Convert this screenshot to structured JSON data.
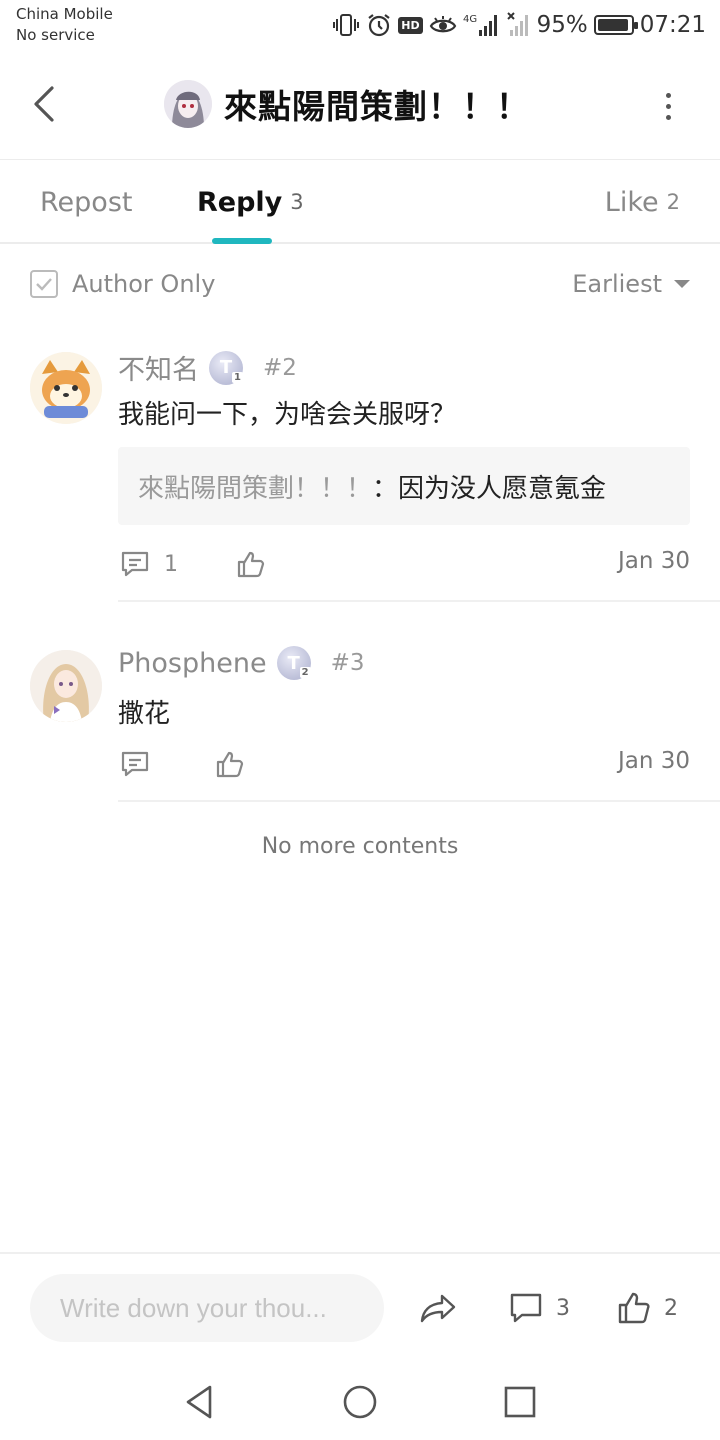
{
  "status_bar": {
    "carrier": "China Mobile",
    "service": "No service",
    "hd_badge": "HD",
    "network": "4G",
    "battery_percent": "95%",
    "battery_level": 0.95,
    "time": "07:21",
    "icons": [
      "vibrate-icon",
      "alarm-icon",
      "hd-icon",
      "eye-comfort-icon",
      "signal-4g-icon",
      "signal-nosim-icon",
      "battery-icon"
    ]
  },
  "header": {
    "title": "來點陽間策劃！！！",
    "back_icon": "chevron-left-icon",
    "more_icon": "more-vertical-icon"
  },
  "tabs": [
    {
      "label": "Repost",
      "count": ""
    },
    {
      "label": "Reply",
      "count": "3",
      "active": true
    },
    {
      "label": "Like",
      "count": "2"
    }
  ],
  "filter": {
    "author_only_label": "Author Only",
    "author_only_checked": false,
    "sort_label": "Earliest"
  },
  "comments": [
    {
      "name": "不知名",
      "tier": "T",
      "tier_level": "1",
      "floor": "#2",
      "text": "我能问一下，为啥会关服呀？",
      "quote": {
        "author": "來點陽間策劃！！！",
        "separator": "：",
        "text": "因为没人愿意氪金"
      },
      "reply_count": "1",
      "date": "Jan 30"
    },
    {
      "name": "Phosphene",
      "tier": "T",
      "tier_level": "2",
      "floor": "#3",
      "text": "撒花",
      "date": "Jan 30"
    }
  ],
  "footer_text": "No more contents",
  "bottom_bar": {
    "input_placeholder": "Write down your thou...",
    "comment_count": "3",
    "like_count": "2"
  },
  "colors": {
    "accent": "#1fb7bf",
    "muted": "#888888",
    "text": "#222222"
  }
}
